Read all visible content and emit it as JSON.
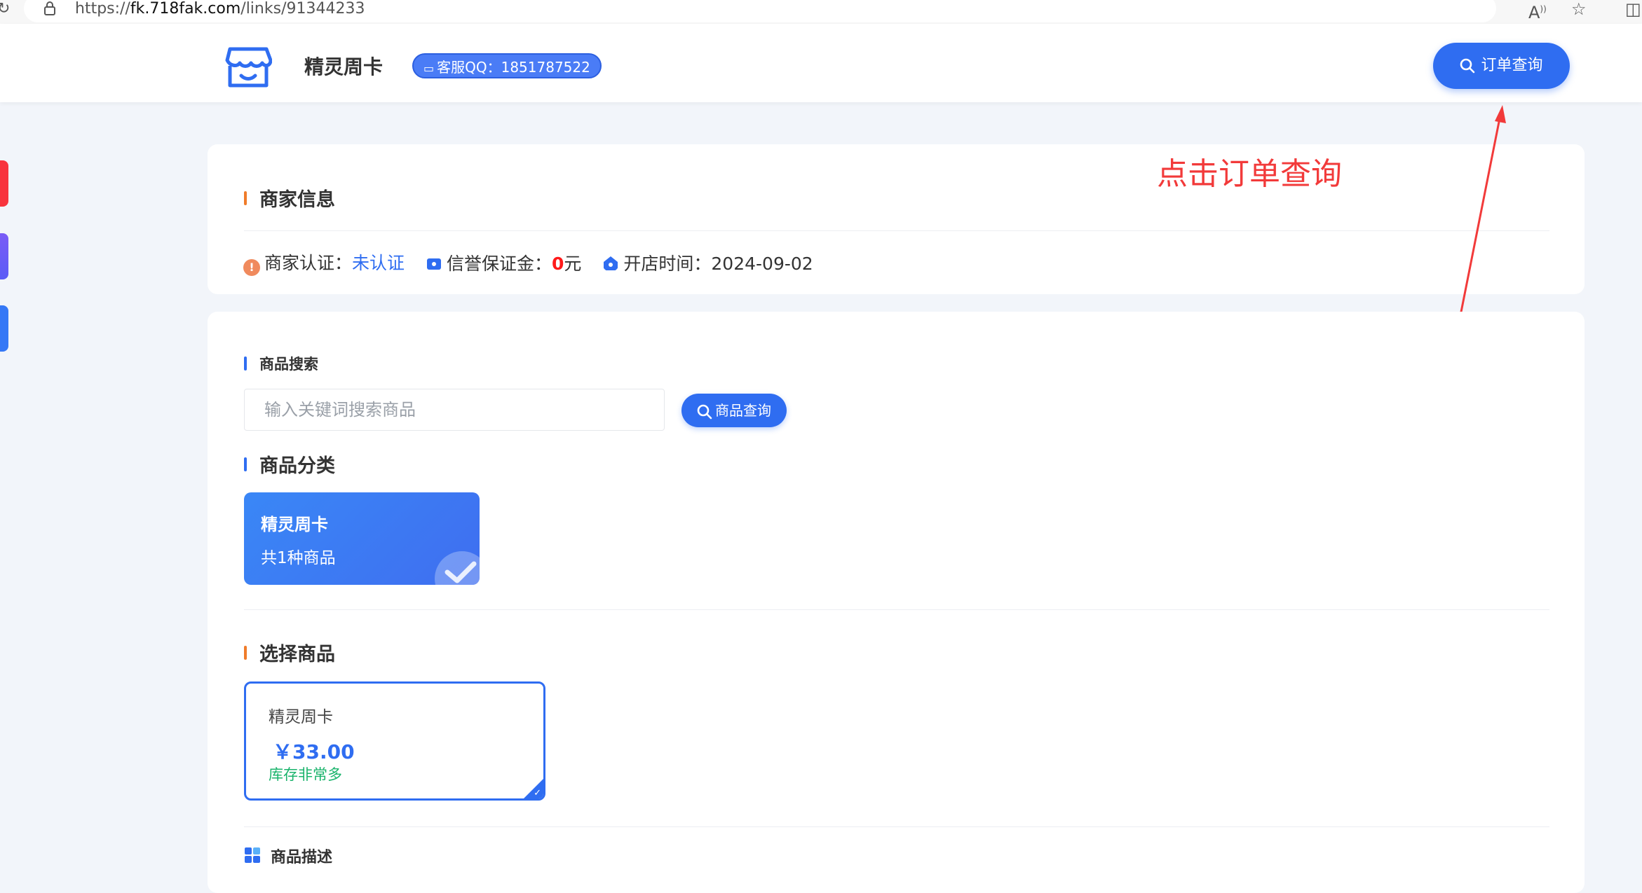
{
  "browser": {
    "url_prefix": "https://",
    "url_host": "fk.718fak.com",
    "url_path": "/links/91344233"
  },
  "header": {
    "shop_name": "精灵周卡",
    "qq_badge": "客服QQ：1851787522",
    "order_query_label": "订单查询"
  },
  "annotation": {
    "text": "点击订单查询",
    "color": "#f23a3a"
  },
  "merchant_info": {
    "title": "商家信息",
    "cert_label": "商家认证：",
    "cert_value": "未认证",
    "deposit_label": "信誉保证金：",
    "deposit_value": "0",
    "deposit_unit": "元",
    "open_label": "开店时间：",
    "open_value": "2024-09-02"
  },
  "product_search": {
    "title": "商品搜索",
    "placeholder": "输入关键词搜索商品",
    "button_label": "商品查询"
  },
  "category": {
    "title": "商品分类",
    "items": [
      {
        "name": "精灵周卡",
        "count_text": "共1种商品"
      }
    ]
  },
  "select_product": {
    "title": "选择商品",
    "items": [
      {
        "name": "精灵周卡",
        "price": "￥33.00",
        "stock": "库存非常多"
      }
    ]
  },
  "description": {
    "title": "商品描述"
  },
  "colors": {
    "accent": "#2f6df1",
    "stock_green": "#19b36b",
    "side_tabs": [
      "#f8343d",
      "#6b5cf6",
      "#3578f6"
    ]
  }
}
